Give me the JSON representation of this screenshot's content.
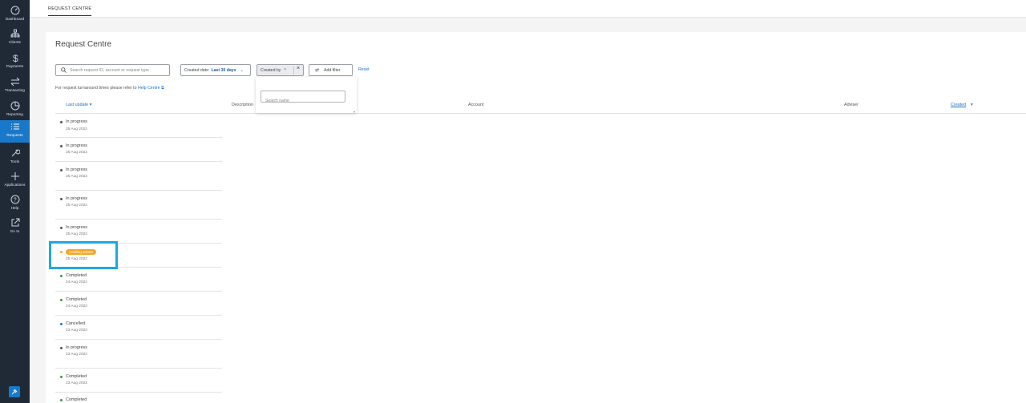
{
  "sidebar": {
    "items": [
      {
        "label": "Dashboard",
        "icon": "gauge-icon"
      },
      {
        "label": "Clients",
        "icon": "org-chart-icon"
      },
      {
        "label": "Payments",
        "icon": "dollar-icon"
      },
      {
        "label": "Transacting",
        "icon": "arrows-swap-icon"
      },
      {
        "label": "Reporting",
        "icon": "pie-chart-icon"
      },
      {
        "label": "Requests",
        "icon": "list-check-icon",
        "active": true
      },
      {
        "label": "Tools",
        "icon": "wrench-icon"
      },
      {
        "label": "Applications",
        "icon": "plus-icon"
      },
      {
        "label": "Help",
        "icon": "question-icon"
      },
      {
        "label": "Go to",
        "icon": "external-link-icon"
      }
    ]
  },
  "topbar": {
    "tab_label": "REQUEST CENTRE"
  },
  "page": {
    "title": "Request Centre"
  },
  "filters": {
    "search_placeholder": "Search request ID, account or request type",
    "date_label": "Created date:",
    "date_value": "Last 30 days",
    "created_by_label": "Created by",
    "add_filter_label": "Add filter",
    "reset_label": "Reset",
    "dropdown_search_placeholder": "Search name"
  },
  "help_note": {
    "text": "For request turnaround times please refer to",
    "link": "Help Centre"
  },
  "columns": {
    "last_update": "Last update",
    "description": "Description",
    "account": "Account",
    "adviser": "Adviser",
    "created": "Created"
  },
  "rows": [
    {
      "status": "In progress",
      "date": "25 Aug 2022"
    },
    {
      "status": "In progress",
      "date": "25 Aug 2022"
    },
    {
      "status": "In progress",
      "date": "25 Aug 2022"
    },
    {
      "status": "In progress",
      "date": "25 Aug 2022"
    },
    {
      "status": "In progress",
      "date": "25 Aug 2022"
    },
    {
      "status": "Awaiting adviser",
      "date": "25 Aug 2022"
    },
    {
      "status": "Completed",
      "date": "24 Aug 2022"
    },
    {
      "status": "Completed",
      "date": "24 Aug 2022"
    },
    {
      "status": "Cancelled",
      "date": "23 Aug 2022"
    },
    {
      "status": "In progress",
      "date": "23 Aug 2022"
    },
    {
      "status": "Completed",
      "date": "23 Aug 2022"
    },
    {
      "status": "Completed",
      "date": ""
    }
  ],
  "colors": {
    "accent": "#1a73c7",
    "sidebar": "#1f2a36",
    "warning": "#f5a623",
    "success": "#2e9d4a",
    "highlight": "#1fa8e0"
  }
}
